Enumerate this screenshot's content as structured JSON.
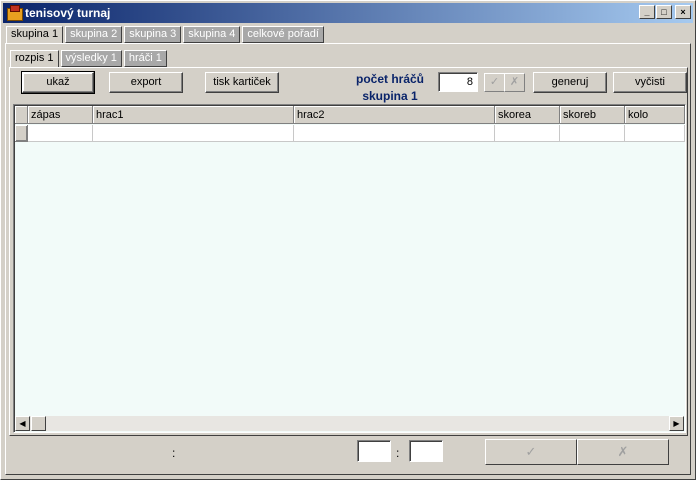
{
  "window": {
    "title": "tenisový turnaj"
  },
  "titlebar_buttons": {
    "minimize": "_",
    "maximize": "□",
    "close": "×"
  },
  "group_tabs": [
    "skupina 1",
    "skupina 2",
    "skupina 3",
    "skupina 4",
    "celkové pořadí"
  ],
  "sub_tabs": [
    "rozpis 1",
    "výsledky 1",
    "hráči 1"
  ],
  "toolbar": {
    "show_label": "ukaž",
    "export_label": "export",
    "print_label": "tisk kartiček",
    "player_count_label": "počet hráčů",
    "group_label": "skupina 1",
    "player_count_value": "8",
    "confirm_icon": "✓",
    "cancel_icon": "✗",
    "generate_label": "generuj",
    "clear_label": "vyčisti"
  },
  "grid": {
    "columns": [
      "zápas",
      "hrac1",
      "hrac2",
      "skorea",
      "skoreb",
      "kolo"
    ],
    "rows": [
      [
        "",
        "",
        "",
        "",
        "",
        ""
      ]
    ]
  },
  "scrollbar": {
    "left_arrow": "◀",
    "right_arrow": "▶"
  },
  "bottom": {
    "left_separator": ":",
    "score_separator": ":",
    "confirm_icon": "✓",
    "cancel_icon": "✗"
  }
}
